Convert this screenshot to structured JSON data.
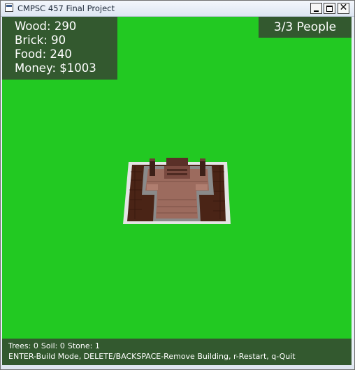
{
  "window": {
    "title": "CMPSC 457 Final Project"
  },
  "hud": {
    "resources": [
      {
        "label": "Wood",
        "value": "290",
        "text": "Wood: 290"
      },
      {
        "label": "Brick",
        "value": "90",
        "text": "Brick: 90"
      },
      {
        "label": "Food",
        "value": "240",
        "text": "Food: 240"
      },
      {
        "label": "Money",
        "value": "$1003",
        "text": "Money: $1003"
      }
    ],
    "people": "3/3 People"
  },
  "status": {
    "counts": [
      "Trees: 0",
      "Soil: 0",
      "Stone: 1"
    ],
    "help": "ENTER-Build Mode, DELETE/BACKSPACE-Remove Building, r-Restart, q-Quit"
  },
  "colors": {
    "ground": "#22c922",
    "hud_panel": "#33592f",
    "hud_text": "#ffffff",
    "plot_border": "#e3e3e3",
    "walkway": "#8c8c8c",
    "building_floor": "#9c6b5e",
    "dirt": "#4a2416"
  }
}
